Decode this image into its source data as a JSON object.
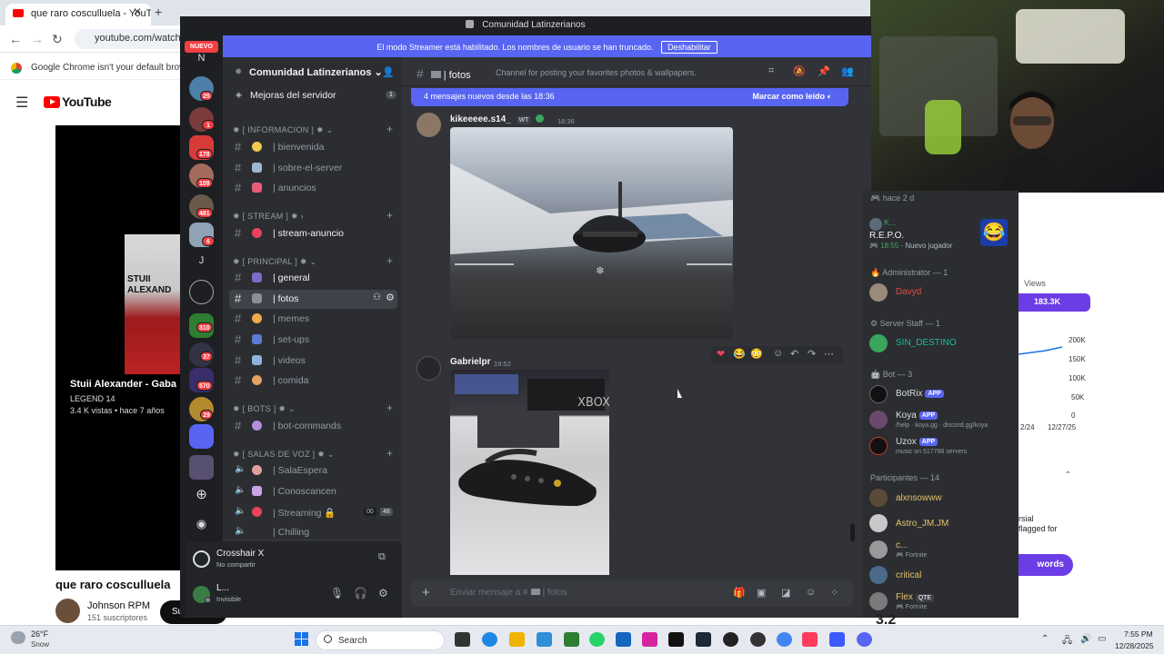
{
  "browser": {
    "tab_title": "que raro cosculluela - YouTube",
    "url": "youtube.com/watch?v=",
    "infobar_text": "Google Chrome isn't your default browser"
  },
  "youtube": {
    "logo_text": "YouTube",
    "thumb_text": "STUII\nALEXAND",
    "video_overlay_title": "Stuii Alexander - Gaba",
    "video_overlay_line1": "LEGEND 14",
    "video_overlay_line2": "3.4 K vistas • hace 7 años",
    "video_title": "que raro cosculluela",
    "channel_name": "Johnson RPM",
    "subscribers": "151 suscriptores",
    "subscribe_label": "Su",
    "views_label": "Views",
    "views_value": "183.3K",
    "axis_labels": [
      "200K",
      "150K",
      "100K",
      "50K",
      "0"
    ],
    "date_labels": [
      "2/24",
      "12/27/25"
    ],
    "right_text": "rsial\nflagged for",
    "words_label": "words",
    "bottom_number": "3.2"
  },
  "discord": {
    "window_title": "Comunidad Latinzerianos",
    "streamer_banner": "El modo Streamer está habilitado. Los nombres de usuario se han truncado.",
    "streamer_button": "Deshabilitar",
    "nuevo_badge": "NUEVO",
    "guild_letters": [
      "N",
      "J"
    ],
    "guild_badges": [
      "25",
      "1",
      "178",
      "109",
      "481",
      "6",
      "310",
      "37",
      "570",
      "29"
    ],
    "server_name": "Comunidad Latinzerianos",
    "boost_label": "Mejoras del servidor",
    "boost_count": "1",
    "categories": {
      "informacion": "[ INFORMACION ]",
      "stream": "[ STREAM ]",
      "principal": "[ PRINCIPAL ]",
      "bots": "[ BOTS ]",
      "voz": "[ SALAS DE VOZ ]"
    },
    "channels": {
      "bienvenida": "| bienvenida",
      "sobre": "| sobre-el-server",
      "anuncios": "| anuncios",
      "stream_anuncio": "| stream-anuncio",
      "general": "| general",
      "fotos": "| fotos",
      "memes": "| memes",
      "setups": "| set-ups",
      "videos": "| videos",
      "comida": "| comida",
      "bot_commands": "| bot-commands",
      "sala_espera": "| SalaEspera",
      "conoscancen": "| Conoscancen",
      "streaming": "| Streaming",
      "chilling": "| Chilling"
    },
    "streaming_counts": [
      "00",
      "48"
    ],
    "activity_name": "Crosshair X",
    "activity_sub": "No compartir",
    "user_name": "L...",
    "user_status": "Invisible",
    "chat": {
      "channel_title": "| fotos",
      "topic": "Channel for posting your favorites photos & wallpapers.",
      "new_messages": "4 mensajes nuevos desde las 18:36",
      "mark_read": "Marcar como leído",
      "msg1_author": "kikeeeee.s14_",
      "msg1_tag": "WT",
      "msg1_time": "18:36",
      "msg2_author": "Gabrielpr",
      "msg2_time": "19:52",
      "input_placeholder": "Enviar mensaje a #",
      "input_channel": "| fotos"
    },
    "members": {
      "top_note": "hace 2 d",
      "activity_user": "K...",
      "activity_game": "R.E.P.O.",
      "activity_time": "18:55",
      "activity_note": "Nuevo jugador",
      "group_admin": "Administrator — 1",
      "admin_name": "Davyd",
      "group_staff": "Server Staff — 1",
      "staff_name": "SIN_DESTINO",
      "group_bot": "Bot — 3",
      "bot1": "BotRix",
      "bot2": "Koya",
      "bot2_sub": "/help · koya.gg · discord.gg/koya",
      "bot3": "Uzox",
      "bot3_sub": "music on 517788 servers",
      "app_label": "APP",
      "group_part": "Participantes — 14",
      "p1": "alxnsowww",
      "p2": "Astro_JM.JM",
      "p3": "c...",
      "p3_sub": "Fortnite",
      "p4": "critical",
      "p5": "Flex",
      "p5_tag": "QTE",
      "p5_sub": "Fortnite"
    }
  },
  "taskbar": {
    "temp": "26°F",
    "weather": "Snow",
    "search_label": "Search",
    "time": "7:55 PM",
    "date": "12/28/2025"
  }
}
